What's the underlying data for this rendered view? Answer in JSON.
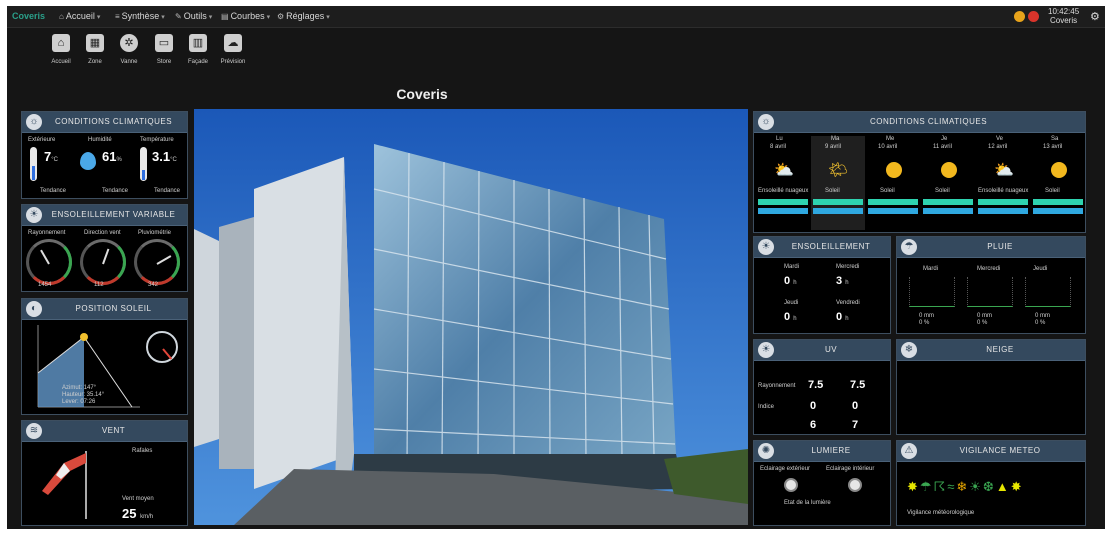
{
  "topbar": {
    "logo": "Coveris",
    "menus": [
      {
        "icon": "home-icon",
        "label": "Accueil"
      },
      {
        "icon": "sliders-icon",
        "label": "Synthèse"
      },
      {
        "icon": "wrench-icon",
        "label": "Outils"
      },
      {
        "icon": "chart-icon",
        "label": "Courbes"
      },
      {
        "icon": "gear-icon",
        "label": "Réglages"
      }
    ],
    "clock_time": "10:42:45",
    "clock_sub": "Coveris",
    "status_colors": [
      "#e8a31b",
      "#d9342b"
    ]
  },
  "shortcuts": [
    {
      "icon": "house-icon",
      "label": "Accueil"
    },
    {
      "icon": "grid-icon",
      "label": "Zone"
    },
    {
      "icon": "fan-icon",
      "label": "Vanne"
    },
    {
      "icon": "panel-icon",
      "label": "Store"
    },
    {
      "icon": "building-icon",
      "label": "Façade"
    },
    {
      "icon": "meteo-icon",
      "label": "Prévision"
    }
  ],
  "page_title": "Coveris",
  "left": {
    "conditions": {
      "title": "CONDITIONS CLIMATIQUES",
      "cols": [
        {
          "label": "Extérieure",
          "value": "7",
          "unit": "°C",
          "foot": "Tendance"
        },
        {
          "label": "Humidité",
          "value": "61",
          "unit": "%",
          "foot": "Tendance"
        },
        {
          "label": "Température",
          "value": "3.1",
          "unit": "°C",
          "foot": "Tendance"
        }
      ]
    },
    "ensoleillement": {
      "title": "ENSOLEILLEMENT VARIABLE",
      "gauges": [
        {
          "label": "Rayonnement",
          "value": "1454"
        },
        {
          "label": "Direction vent",
          "value": "112"
        },
        {
          "label": "Pluviométrie",
          "value": "342"
        }
      ]
    },
    "position": {
      "title": "POSITION SOLEIL",
      "lines": [
        "Azimut: 147°",
        "Hauteur: 35.14°",
        "Lever: 07:26"
      ]
    },
    "vent": {
      "title": "VENT",
      "label1": "Rafales",
      "label2": "Vent moyen",
      "value": "25",
      "unit": "km/h"
    }
  },
  "right": {
    "conditions": {
      "title": "CONDITIONS CLIMATIQUES",
      "days": [
        {
          "day": "Lu",
          "date": "8 avril",
          "weather": "cloud-sun",
          "desc": "Ensoleillé nuageux"
        },
        {
          "day": "Ma",
          "date": "9 avril",
          "weather": "sun-cloud",
          "desc": "Soleil"
        },
        {
          "day": "Me",
          "date": "10 avril",
          "weather": "sun",
          "desc": "Soleil"
        },
        {
          "day": "Je",
          "date": "11 avril",
          "weather": "sun",
          "desc": "Soleil"
        },
        {
          "day": "Ve",
          "date": "12 avril",
          "weather": "cloud-sun",
          "desc": "Ensoleillé nuageux"
        },
        {
          "day": "Sa",
          "date": "13 avril",
          "weather": "sun",
          "desc": "Soleil"
        }
      ]
    },
    "ensoleillement": {
      "title": "ENSOLEILLEMENT",
      "cells": [
        {
          "label": "Mardi",
          "value": "0",
          "unit": "h"
        },
        {
          "label": "Mercredi",
          "value": "3",
          "unit": "h"
        },
        {
          "label": "Jeudi",
          "value": "0",
          "unit": "h"
        },
        {
          "label": "Vendredi",
          "value": "0",
          "unit": "h"
        }
      ]
    },
    "pluie": {
      "title": "PLUIE",
      "cols": [
        {
          "label": "Mardi",
          "amount": "0 mm",
          "sub": "0 %"
        },
        {
          "label": "Mercredi",
          "amount": "0 mm",
          "sub": "0 %"
        },
        {
          "label": "Jeudi",
          "amount": "0 mm",
          "sub": "0 %"
        }
      ]
    },
    "uv": {
      "title": "UV",
      "rows": [
        {
          "label": "Rayonnement",
          "a": "7.5",
          "b": "7.5"
        },
        {
          "label": "Indice",
          "a": "0",
          "b": "0"
        },
        {
          "label": "",
          "a": "6",
          "b": "7"
        }
      ]
    },
    "neige": {
      "title": "NEIGE"
    },
    "lumiere": {
      "title": "LUMIERE",
      "label_a": "Eclairage extérieur",
      "label_b": "Eclairage intérieur",
      "foot": "Etat de la lumière"
    },
    "vigilance": {
      "title": "VIGILANCE METEO",
      "foot": "Vigilance météorologique"
    }
  }
}
